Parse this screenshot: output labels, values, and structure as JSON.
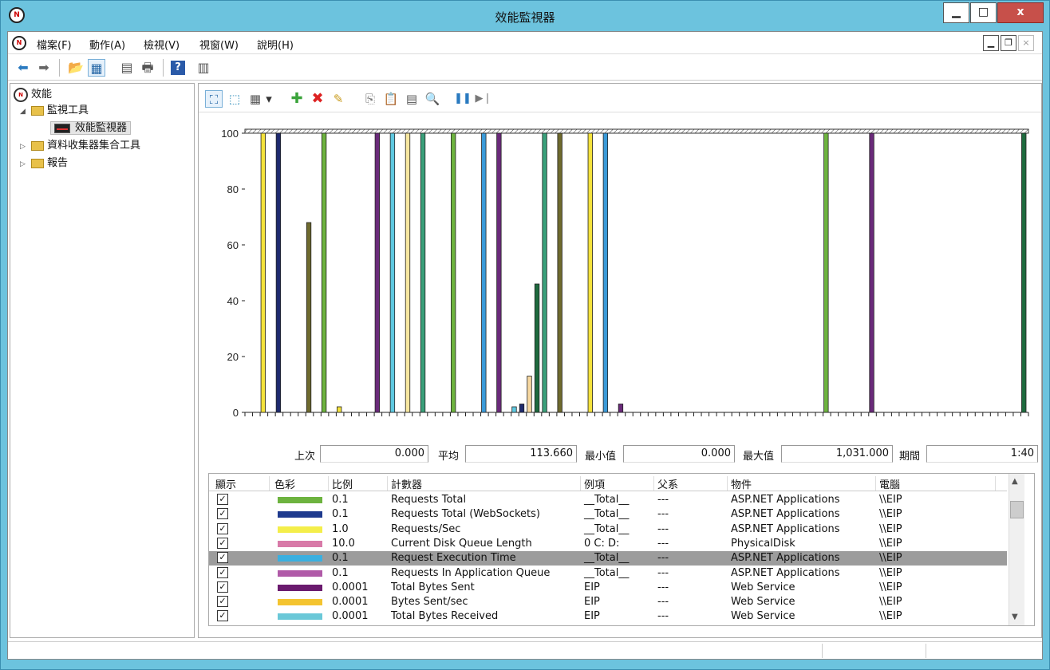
{
  "window": {
    "title": "效能監視器",
    "app_icon_glyph": "N",
    "controls": {
      "minimize": "▁",
      "maximize": "□",
      "close": "x"
    }
  },
  "menubar": {
    "items": [
      {
        "label": "檔案(F)"
      },
      {
        "label": "動作(A)"
      },
      {
        "label": "檢視(V)"
      },
      {
        "label": "視窗(W)"
      },
      {
        "label": "說明(H)"
      }
    ],
    "mdi_controls": {
      "minimize": "▁",
      "restore": "❐",
      "close": "×"
    }
  },
  "toolbar": {
    "icons": [
      "back-arrow-icon",
      "forward-arrow-icon",
      "up-folder-icon",
      "show-hide-console-tree-icon",
      "properties-icon",
      "print-icon",
      "help-icon",
      "show-hide-action-pane-icon"
    ],
    "glyphs": {
      "back": "⬅",
      "forward": "➡",
      "up": "📂",
      "tree": "▦",
      "props": "▤",
      "print": "🖶",
      "help": "?",
      "pane": "▥"
    }
  },
  "tree": {
    "root": {
      "label": "效能",
      "icon_glyph": "N"
    },
    "monitoring_tools": {
      "label": "監視工具",
      "arrow": "◢"
    },
    "performance_monitor": {
      "label": "效能監視器"
    },
    "data_collector_sets": {
      "label": "資料收集器集合工具",
      "arrow": "▷"
    },
    "reports": {
      "label": "報告",
      "arrow": "▷"
    }
  },
  "graph_toolbar": {
    "icons": [
      "view-current-activity-icon",
      "view-log-data-icon",
      "change-graph-type-icon",
      "dropdown-arrow-icon",
      "add-counter-icon",
      "delete-counter-icon",
      "highlight-icon",
      "copy-properties-icon",
      "paste-counter-list-icon",
      "properties-icon",
      "zoom-icon",
      "freeze-display-icon",
      "update-data-icon"
    ],
    "glyphs": {
      "view": "⛶",
      "log": "⬚",
      "type": "▦",
      "drop": "▾",
      "add": "✚",
      "delete": "✖",
      "highlight": "✎",
      "copy": "⎘",
      "paste": "📋",
      "props": "▤",
      "zoom": "🔍",
      "freeze": "❚❚",
      "update": "▶❘"
    },
    "colors": {
      "add": "#3aa33a",
      "delete": "#d22",
      "freeze": "#2a7ac0"
    }
  },
  "chart_data": {
    "type": "bar",
    "ylim": [
      0,
      100
    ],
    "y_ticks": [
      "0",
      "20",
      "40",
      "60",
      "80",
      "100"
    ],
    "bars": [
      {
        "x": 2,
        "value": 100,
        "color": "#f4e23c"
      },
      {
        "x": 4,
        "value": 100,
        "color": "#1e2a6e"
      },
      {
        "x": 8,
        "value": 68,
        "color": "#6e6a2e"
      },
      {
        "x": 10,
        "value": 100,
        "color": "#6db33f"
      },
      {
        "x": 12,
        "value": 2,
        "color": "#f4e23c"
      },
      {
        "x": 17,
        "value": 100,
        "color": "#6a2a7a"
      },
      {
        "x": 19,
        "value": 100,
        "color": "#5ec8e0"
      },
      {
        "x": 21,
        "value": 100,
        "color": "#f7e7a0"
      },
      {
        "x": 23,
        "value": 100,
        "color": "#3aa07a"
      },
      {
        "x": 27,
        "value": 100,
        "color": "#6db33f"
      },
      {
        "x": 31,
        "value": 100,
        "color": "#3a9ad8"
      },
      {
        "x": 33,
        "value": 100,
        "color": "#6a2a7a"
      },
      {
        "x": 35,
        "value": 2,
        "color": "#5ec8e0"
      },
      {
        "x": 36,
        "value": 3,
        "color": "#1e2a6e"
      },
      {
        "x": 37,
        "value": 13,
        "color": "#f7d8a0"
      },
      {
        "x": 38,
        "value": 46,
        "color": "#1e6a3e"
      },
      {
        "x": 39,
        "value": 100,
        "color": "#3aa07a"
      },
      {
        "x": 41,
        "value": 100,
        "color": "#6e6a2e"
      },
      {
        "x": 45,
        "value": 100,
        "color": "#f4e23c"
      },
      {
        "x": 47,
        "value": 100,
        "color": "#3a9ad8"
      },
      {
        "x": 49,
        "value": 3,
        "color": "#6a2a7a"
      },
      {
        "x": 76,
        "value": 100,
        "color": "#6db33f"
      },
      {
        "x": 82,
        "value": 100,
        "color": "#6a2a7a"
      },
      {
        "x": 102,
        "value": 100,
        "color": "#1e6a3e"
      }
    ],
    "n_slots": 103
  },
  "stats": {
    "last_label": "上次",
    "last_value": "0.000",
    "avg_label": "平均",
    "avg_value": "113.660",
    "min_label": "最小值",
    "min_value": "0.000",
    "max_label": "最大值",
    "max_value": "1,031.000",
    "duration_label": "期間",
    "duration_value": "1:40"
  },
  "counter_list": {
    "headers": [
      "顯示",
      "色彩",
      "比例",
      "計數器",
      "例項",
      "父系",
      "物件",
      "電腦"
    ],
    "rows": [
      {
        "checked": "✓",
        "color": "#6db33f",
        "scale": "0.1",
        "counter": "Requests Total",
        "instance": "__Total__",
        "parent": "---",
        "object": "ASP.NET Applications",
        "computer": "\\\\EIP",
        "selected": false
      },
      {
        "checked": "✓",
        "color": "#1e3a8e",
        "scale": "0.1",
        "counter": "Requests Total (WebSockets)",
        "instance": "__Total__",
        "parent": "---",
        "object": "ASP.NET Applications",
        "computer": "\\\\EIP",
        "selected": false
      },
      {
        "checked": "✓",
        "color": "#f4ee4a",
        "scale": "1.0",
        "counter": "Requests/Sec",
        "instance": "__Total__",
        "parent": "---",
        "object": "ASP.NET Applications",
        "computer": "\\\\EIP",
        "selected": false
      },
      {
        "checked": "✓",
        "color": "#d87aa8",
        "scale": "10.0",
        "counter": "Current Disk Queue Length",
        "instance": "0 C: D:",
        "parent": "---",
        "object": "PhysicalDisk",
        "computer": "\\\\EIP",
        "selected": false
      },
      {
        "checked": "✓",
        "color": "#3ab0e0",
        "scale": "0.1",
        "counter": "Request Execution Time",
        "instance": "__Total__",
        "parent": "---",
        "object": "ASP.NET Applications",
        "computer": "\\\\EIP",
        "selected": true
      },
      {
        "checked": "✓",
        "color": "#b05aa8",
        "scale": "0.1",
        "counter": "Requests In Application Queue",
        "instance": "__Total__",
        "parent": "---",
        "object": "ASP.NET Applications",
        "computer": "\\\\EIP",
        "selected": false
      },
      {
        "checked": "✓",
        "color": "#6a1a6e",
        "scale": "0.0001",
        "counter": "Total Bytes Sent",
        "instance": "EIP",
        "parent": "---",
        "object": "Web Service",
        "computer": "\\\\EIP",
        "selected": false
      },
      {
        "checked": "✓",
        "color": "#f4c430",
        "scale": "0.0001",
        "counter": "Bytes Sent/sec",
        "instance": "EIP",
        "parent": "---",
        "object": "Web Service",
        "computer": "\\\\EIP",
        "selected": false
      },
      {
        "checked": "✓",
        "color": "#6ac8d8",
        "scale": "0.0001",
        "counter": "Total Bytes Received",
        "instance": "EIP",
        "parent": "---",
        "object": "Web Service",
        "computer": "\\\\EIP",
        "selected": false
      }
    ],
    "scroll_up": "▲",
    "scroll_down": "▼"
  }
}
